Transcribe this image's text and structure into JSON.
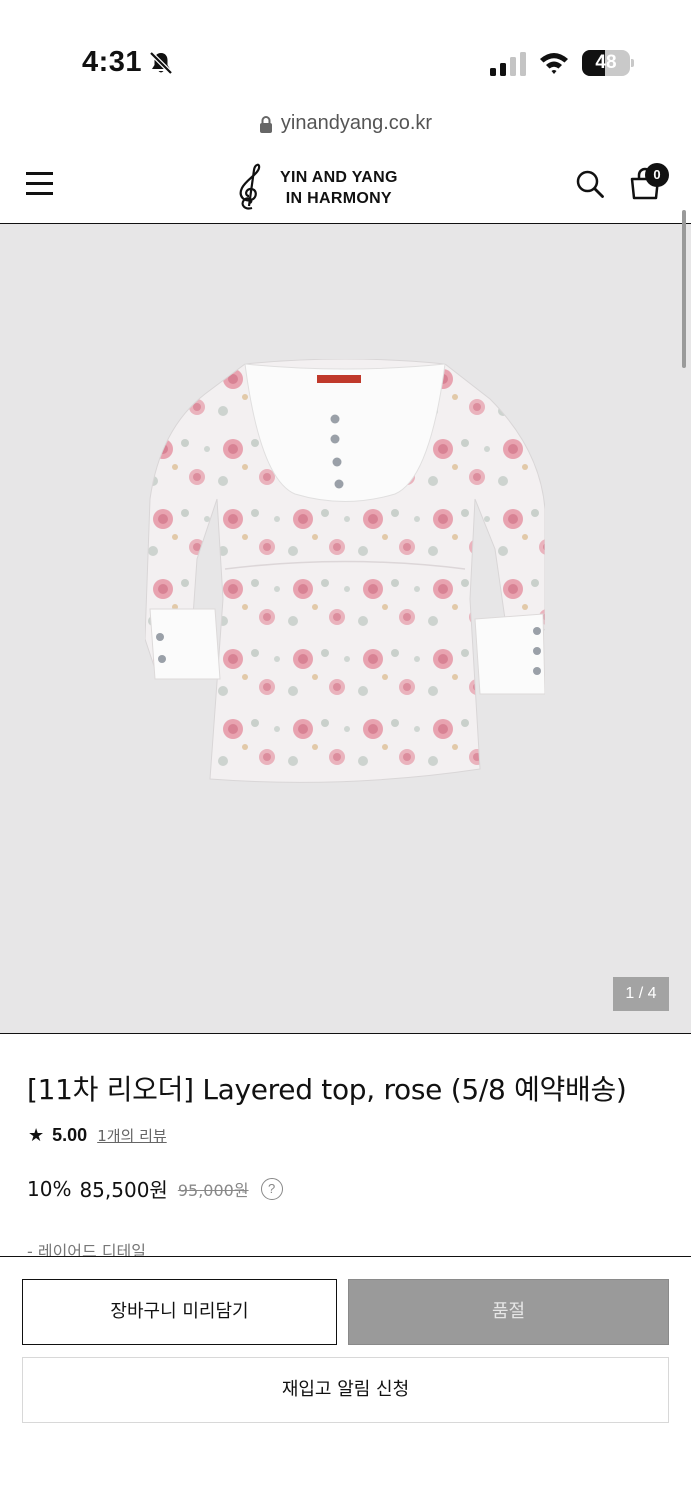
{
  "status_bar": {
    "time": "4:31",
    "battery_level": "48",
    "battery_fraction": 0.48,
    "icons": [
      "bell-slash-icon",
      "signal-icon",
      "wifi-icon",
      "battery-icon"
    ]
  },
  "browser": {
    "url": "yinandyang.co.kr"
  },
  "header": {
    "logo_line1": "YIN AND YANG",
    "logo_line2": "IN HARMONY",
    "cart_count": "0"
  },
  "gallery": {
    "counter": "1 / 4",
    "background_color": "#e7e6e7"
  },
  "product": {
    "title": "[11차 리오더] Layered top, rose (5/8 예약배송)",
    "rating_star": "★",
    "rating": "5.00",
    "review_link": "1개의 리뷰",
    "discount": "10%",
    "price": "85,500원",
    "original_price": "95,000원",
    "help_symbol": "?",
    "detail_preview": "- 레이어드 디테일"
  },
  "actions": {
    "add_to_cart_label": "장바구니 미리담기",
    "sold_out_label": "품절",
    "restock_label": "재입고 알림 신청"
  }
}
